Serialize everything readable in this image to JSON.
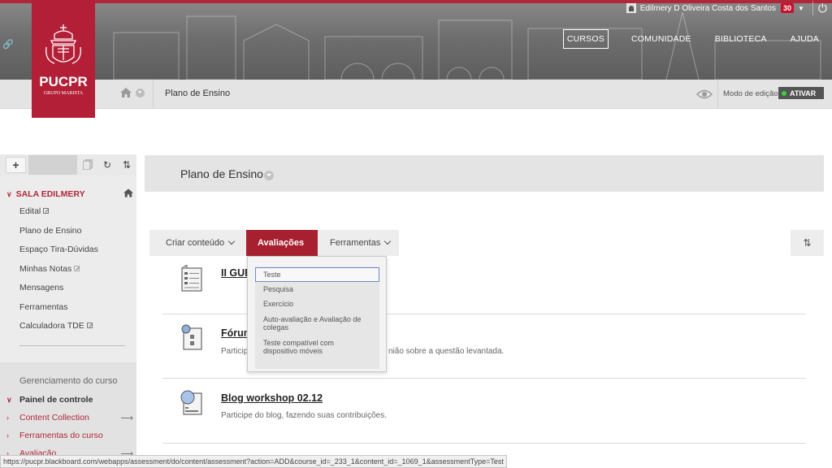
{
  "header": {
    "user_name": "Edilmery D Oliveira Costa dos Santos",
    "notifications": "30",
    "nav": [
      "CURSOS",
      "COMUNIDADE",
      "BIBLIOTECA",
      "AJUDA"
    ],
    "logo_name": "PUCPR",
    "logo_sub": "GRUPO MARISTA"
  },
  "breadcrumb": {
    "current": "Plano de Ensino",
    "edit_mode_label": "Modo de edição",
    "edit_mode_state": "ATIVAR"
  },
  "sidebar": {
    "course_title": "SALA EDILMERY",
    "links": [
      {
        "label": "Edital",
        "external": true
      },
      {
        "label": "Plano de Ensino",
        "external": false
      },
      {
        "label": "Espaço Tira-Dúvidas",
        "external": false
      },
      {
        "label": "Minhas Notas",
        "external": false
      },
      {
        "label": "Mensagens",
        "external": false
      },
      {
        "label": "Ferramentas",
        "external": false
      },
      {
        "label": "Calculadora TDE",
        "external": true
      }
    ],
    "management_title": "Gerenciamento do curso",
    "management_items": [
      "Painel de controle",
      "Content Collection",
      "Ferramentas do curso",
      "Avaliação"
    ]
  },
  "content": {
    "page_title": "Plano de Ensino",
    "actions": [
      "Criar conteúdo",
      "Avaliações",
      "Ferramentas"
    ],
    "items": [
      {
        "title": "II GUE",
        "description": ""
      },
      {
        "title": "Fórum",
        "description_left": "Particip",
        "description_right": "nião sobre a questão levantada."
      },
      {
        "title": "Blog workshop 02.12",
        "description": "Participe do blog, fazendo suas contribuições."
      }
    ]
  },
  "dropdown": {
    "items": [
      "Teste",
      "Pesquisa",
      "Exercício",
      "Auto-avaliação e Avaliação de colegas",
      "Teste compatível com dispositivo móveis"
    ]
  },
  "status_url": "https://pucpr.blackboard.com/webapps/assessment/do/content/assessment?action=ADD&course_id=_233_1&content_id=_1069_1&assessmentType=Test",
  "colors": {
    "brand_red": "#b31f36",
    "active_tab": "#a6202f",
    "edit_on": "#3ad13a"
  }
}
